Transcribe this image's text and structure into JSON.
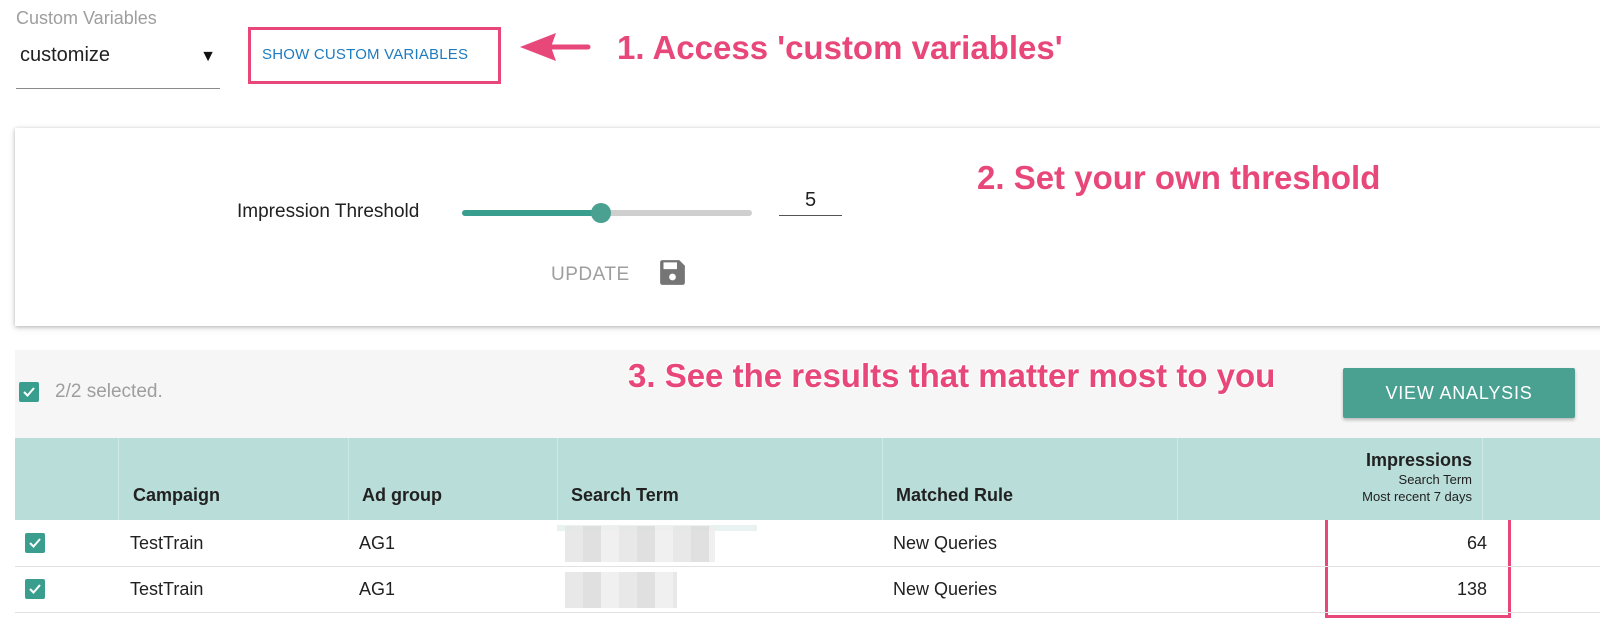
{
  "custom_variables": {
    "label": "Custom Variables",
    "selected": "customize",
    "show_button": "SHOW CUSTOM VARIABLES"
  },
  "annotations": {
    "step1": "1. Access 'custom variables'",
    "step2": "2. Set your own threshold",
    "step3": "3. See the results that matter most to you"
  },
  "threshold": {
    "label": "Impression Threshold",
    "value": "5",
    "slider_fraction": 0.48,
    "update_label": "UPDATE"
  },
  "selection": {
    "text": "2/2 selected.",
    "view_button": "VIEW ANALYSIS"
  },
  "table": {
    "columns": {
      "campaign": "Campaign",
      "ad_group": "Ad group",
      "search_term": "Search Term",
      "matched_rule": "Matched Rule",
      "impressions": "Impressions",
      "impressions_sub1": "Search Term",
      "impressions_sub2": "Most recent 7 days"
    },
    "rows": [
      {
        "campaign": "TestTrain",
        "ad_group": "AG1",
        "matched_rule": "New Queries",
        "impressions": "64"
      },
      {
        "campaign": "TestTrain",
        "ad_group": "AG1",
        "matched_rule": "New Queries",
        "impressions": "138"
      }
    ]
  },
  "colors": {
    "accent": "#e8477a",
    "teal": "#4aa192",
    "header_bg": "#b9ddd9",
    "link": "#1e7bbf"
  }
}
